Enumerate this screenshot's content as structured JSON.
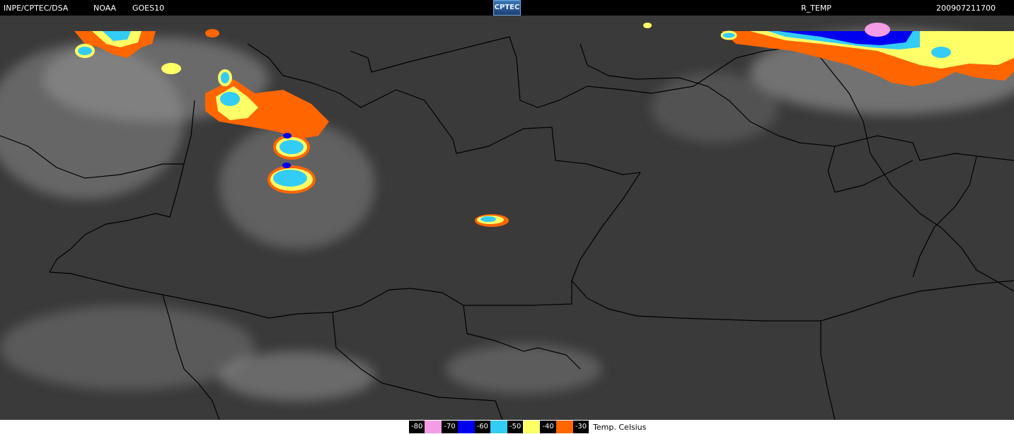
{
  "header": {
    "agency": "INPE/CPTEC/DSA",
    "source": "NOAA",
    "satellite": "GOES10",
    "logo_text": "CPTEC",
    "product": "R_TEMP",
    "timestamp": "200907211700"
  },
  "legend": {
    "items": [
      {
        "label": "-80",
        "color": "#f59ce6"
      },
      {
        "label": "-70",
        "color": "#0000f0"
      },
      {
        "label": "-60",
        "color": "#33ccf5"
      },
      {
        "label": "-50",
        "color": "#ffff66"
      },
      {
        "label": "-40",
        "color": "#ff6600"
      },
      {
        "label": "-30",
        "color": null
      }
    ],
    "unit": "Temp. Celsius"
  },
  "colors": {
    "background": "#3b3b3b",
    "borders": "#000000",
    "cloud": "#bdbdbd"
  }
}
